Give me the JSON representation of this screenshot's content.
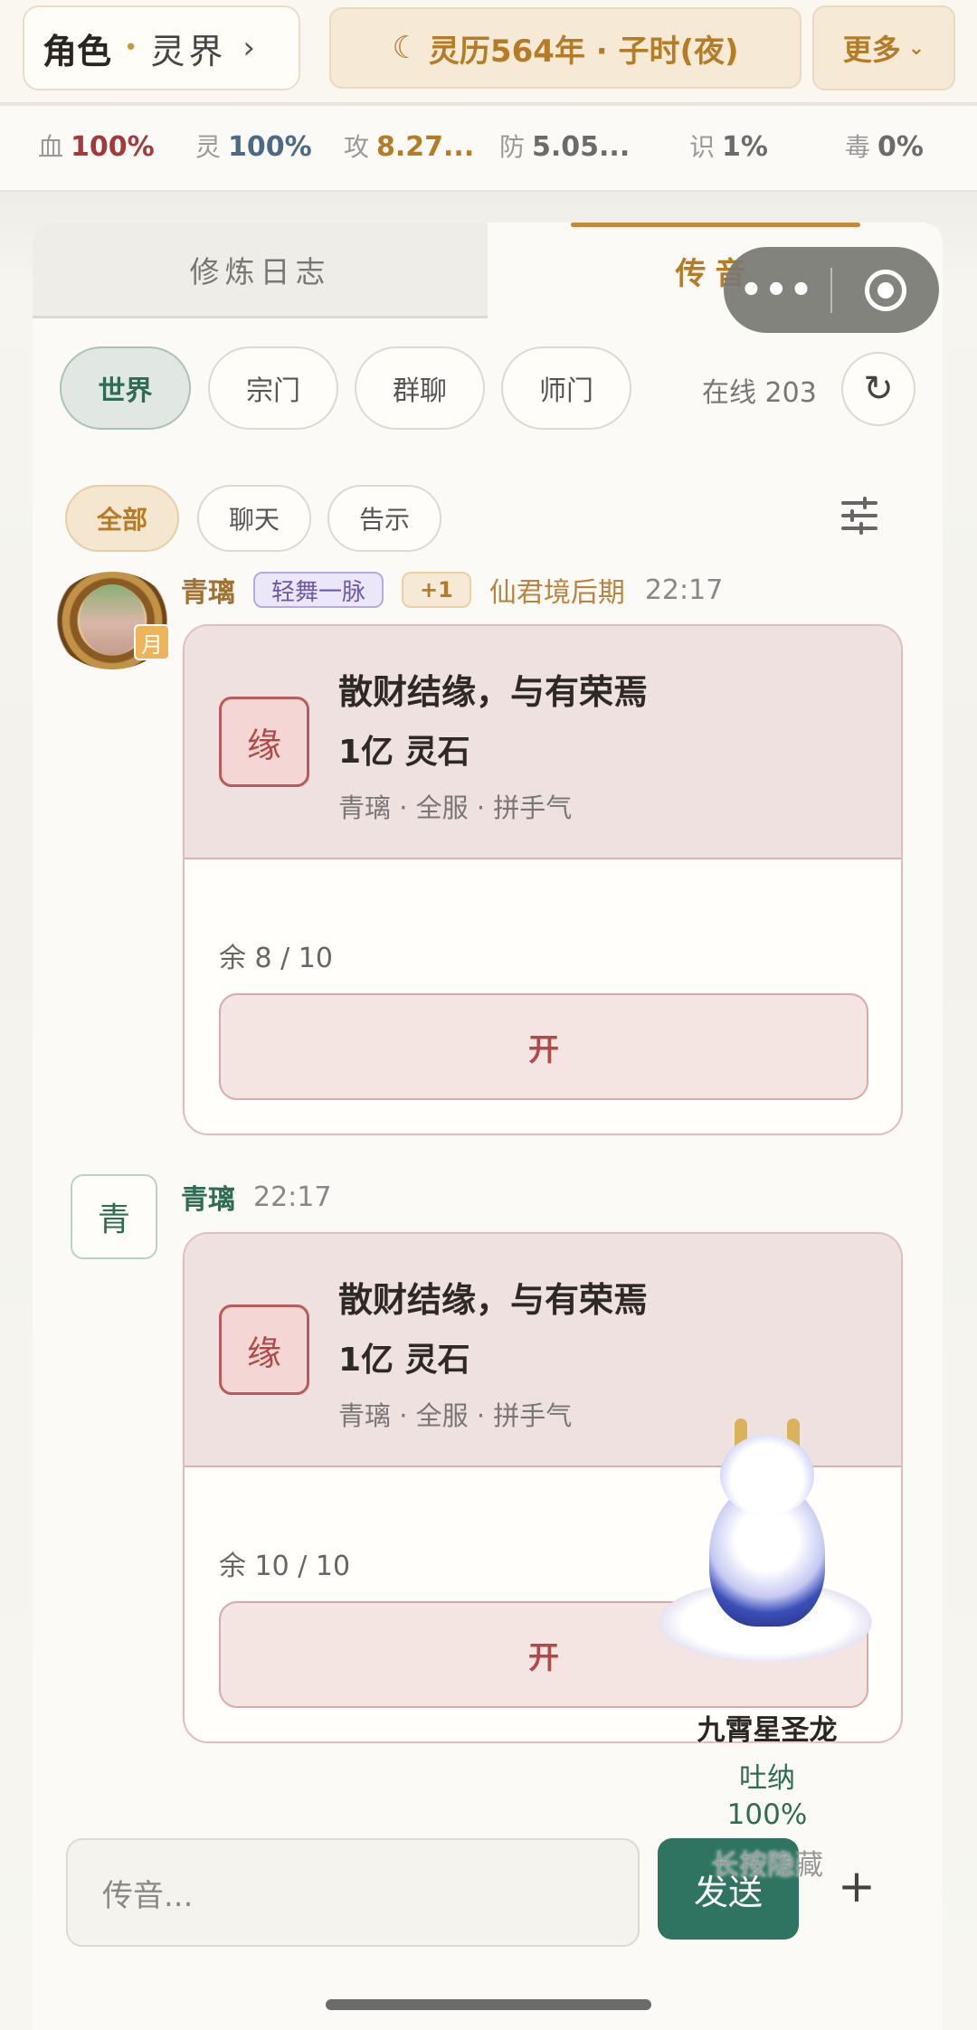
{
  "topbar": {
    "role_label": "角色",
    "dot": "•",
    "realm_label": "灵界",
    "chevron": "›",
    "calendar_icon": "☾",
    "calendar_text": "灵历564年 · 子时(夜)",
    "more_label": "更多",
    "more_caret": "⌄"
  },
  "stats": [
    {
      "key": "血",
      "value": "100%",
      "color": "#a33a3a"
    },
    {
      "key": "灵",
      "value": "100%",
      "color": "#4c6a86"
    },
    {
      "key": "攻",
      "value": "8.27...",
      "color": "#b57b25"
    },
    {
      "key": "防",
      "value": "5.05...",
      "color": "#6b6b6b"
    },
    {
      "key": "识",
      "value": "1%",
      "color": "#6b6b6b"
    },
    {
      "key": "毒",
      "value": "0%",
      "color": "#6b6b6b"
    }
  ],
  "tabs": {
    "log": "修炼日志",
    "message": "传音"
  },
  "capsule": {
    "more": "•••"
  },
  "channels": [
    "世界",
    "宗门",
    "群聊",
    "师门"
  ],
  "online": "在线 203",
  "refresh_icon": "↻",
  "filters": [
    "全部",
    "聊天",
    "告示"
  ],
  "messages": [
    {
      "name": "青璃",
      "sect": "轻舞一脉",
      "plus": "+1",
      "rank": "仙君境后期",
      "time": "22:17",
      "avatar_badge": "月",
      "card": {
        "badge": "缘",
        "title": "散财结缘，与有荣焉",
        "amount": "1亿 灵石",
        "sub": "青璃 · 全服 · 拼手气",
        "remain": "余 8 / 10",
        "open": "开"
      }
    },
    {
      "name": "青璃",
      "time": "22:17",
      "avatar_char": "青",
      "card": {
        "badge": "缘",
        "title": "散财结缘，与有荣焉",
        "amount": "1亿 灵石",
        "sub": "青璃 · 全服 · 拼手气",
        "remain": "余 10 / 10",
        "open": "开"
      }
    }
  ],
  "pet": {
    "name": "九霄星圣龙",
    "action": "吐纳",
    "percent": "100%",
    "hint": "长按隐藏"
  },
  "composer": {
    "placeholder": "传音...",
    "send": "发送",
    "plus": "+"
  },
  "colors": {
    "accent_gold": "#b57b25",
    "accent_green": "#2e7460",
    "red_packet": "#b04a4a"
  }
}
